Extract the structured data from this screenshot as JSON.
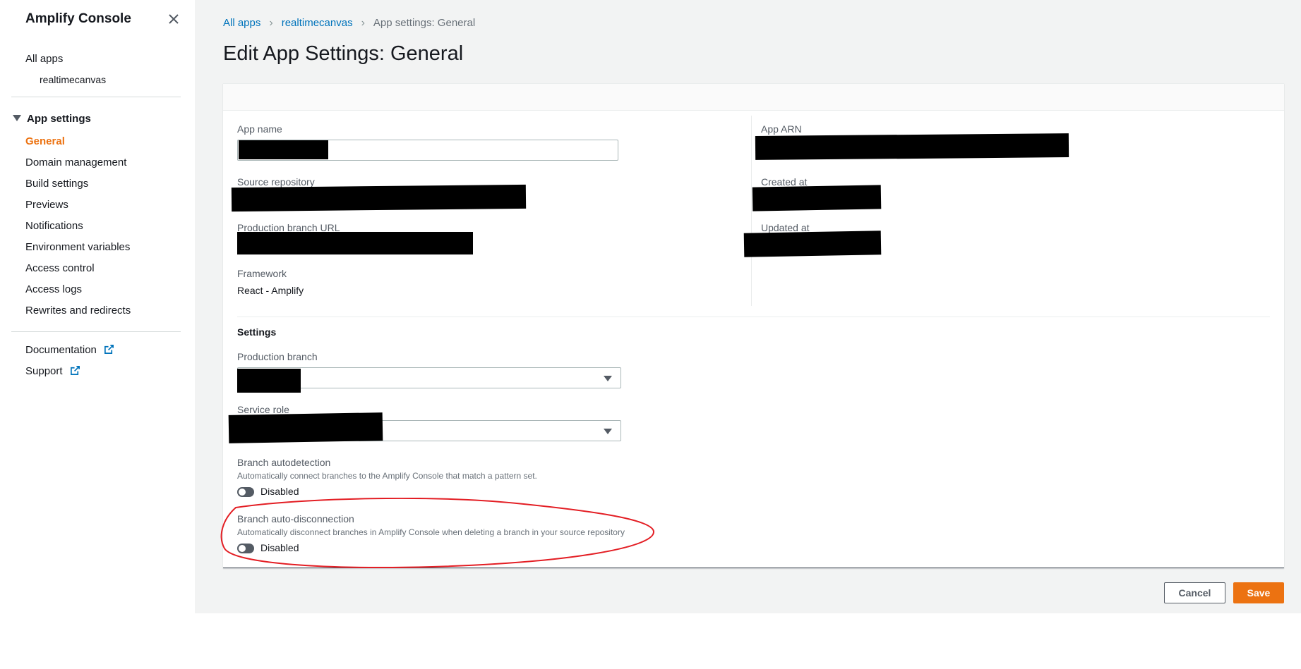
{
  "sidebar": {
    "title": "Amplify Console",
    "all_apps": "All apps",
    "app_name": "realtimecanvas",
    "section": "App settings",
    "items": [
      {
        "label": "General",
        "active": true
      },
      {
        "label": "Domain management"
      },
      {
        "label": "Build settings"
      },
      {
        "label": "Previews"
      },
      {
        "label": "Notifications"
      },
      {
        "label": "Environment variables"
      },
      {
        "label": "Access control"
      },
      {
        "label": "Access logs"
      },
      {
        "label": "Rewrites and redirects"
      }
    ],
    "documentation": "Documentation",
    "support": "Support"
  },
  "breadcrumb": {
    "all_apps": "All apps",
    "app": "realtimecanvas",
    "current": "App settings: General"
  },
  "page_title": "Edit App Settings: General",
  "details": {
    "app_name_label": "App name",
    "source_repo_label": "Source repository",
    "prod_url_label": "Production branch URL",
    "framework_label": "Framework",
    "framework_value": "React - Amplify",
    "app_arn_label": "App ARN",
    "created_label": "Created at",
    "updated_label": "Updated at"
  },
  "settings": {
    "title": "Settings",
    "prod_branch_label": "Production branch",
    "service_role_label": "Service role",
    "autodetect_label": "Branch autodetection",
    "autodetect_desc": "Automatically connect branches to the Amplify Console that match a pattern set.",
    "autodetect_state": "Disabled",
    "autodisconnect_label": "Branch auto-disconnection",
    "autodisconnect_desc": "Automatically disconnect branches in Amplify Console when deleting a branch in your source repository",
    "autodisconnect_state": "Disabled"
  },
  "actions": {
    "cancel": "Cancel",
    "save": "Save"
  },
  "colors": {
    "accent": "#ec7211",
    "link": "#0073bb",
    "annotation": "#e31e24"
  }
}
